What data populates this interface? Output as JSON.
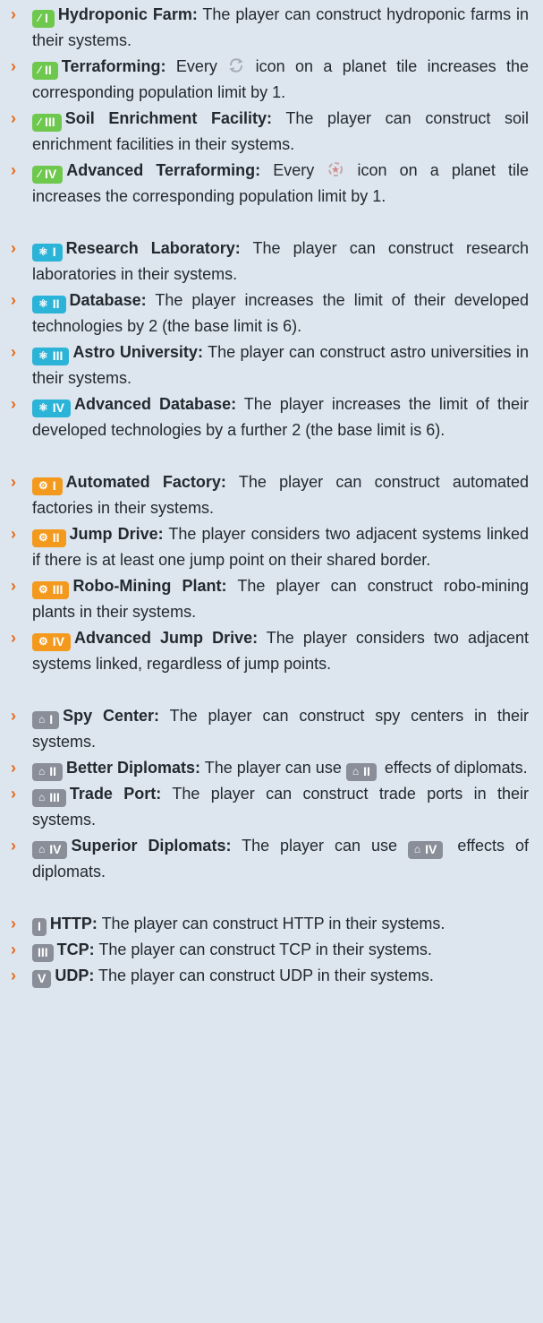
{
  "colors": {
    "green": "#6ec84e",
    "blue": "#2bb4d8",
    "orange": "#f39a1e",
    "gray": "#898e99",
    "arrow": "#e96a1b"
  },
  "items": [
    {
      "badge": "I",
      "sym": "∕",
      "name": "Hydroponic Farm:",
      "desc": " The player can construct hydroponic farms in their systems."
    },
    {
      "badge": "II",
      "sym": "∕",
      "name": "Terraforming:",
      "pre": " Every ",
      "post": " icon on a planet tile increases the corresponding population limit by 1."
    },
    {
      "badge": "III",
      "sym": "∕",
      "name": "Soil Enrichment Facility:",
      "desc": " The player can construct soil enrichment facilities in their systems."
    },
    {
      "badge": "IV",
      "sym": "∕",
      "name": "Advanced Terraforming:",
      "pre": " Every ",
      "post": " icon on a planet tile increases the corresponding population limit by 1."
    },
    {
      "badge": "I",
      "sym": "⚛",
      "name": "Research Laboratory:",
      "desc": " The player can construct research laboratories in their systems."
    },
    {
      "badge": "II",
      "sym": "⚛",
      "name": "Database:",
      "desc": " The player increases the limit of their developed technologies by 2 (the base limit is 6)."
    },
    {
      "badge": "III",
      "sym": "⚛",
      "name": "Astro University:",
      "desc": " The player can construct astro universities in their systems."
    },
    {
      "badge": "IV",
      "sym": "⚛",
      "name": "Advanced Database:",
      "desc": " The player increases the limit of their developed technologies by a further 2 (the base limit is 6)."
    },
    {
      "badge": "I",
      "sym": "⚙",
      "name": "Automated Factory:",
      "desc": " The player can construct automated factories in their systems."
    },
    {
      "badge": "II",
      "sym": "⚙",
      "name": "Jump Drive:",
      "desc": " The player considers two adjacent systems linked if there is at least one jump point on their shared border."
    },
    {
      "badge": "III",
      "sym": "⚙",
      "name": "Robo-Mining Plant:",
      "desc": " The player can construct robo-mining plants in their systems."
    },
    {
      "badge": "IV",
      "sym": "⚙",
      "name": "Advanced Jump Drive:",
      "desc": " The player considers two adjacent systems linked, regardless of jump points."
    },
    {
      "badge": "I",
      "sym": "⌂",
      "name": "Spy Center:",
      "desc": " The player can construct spy centers in their systems."
    },
    {
      "badge": "II",
      "sym": "⌂",
      "name": "Better Diplomats:",
      "pre": " The player can use ",
      "post": " effects of diplomats.",
      "inline_badge": "II"
    },
    {
      "badge": "III",
      "sym": "⌂",
      "name": "Trade Port:",
      "desc": " The player can construct trade ports in their systems."
    },
    {
      "badge": "IV",
      "sym": "⌂",
      "name": "Superior Diplomats:",
      "pre": " The player can use ",
      "post": " effects of diplomats.",
      "inline_badge": "IV"
    },
    {
      "badge": "I",
      "name": "HTTP:",
      "desc": " The player can construct HTTP in their systems."
    },
    {
      "badge": "III",
      "name": "TCP:",
      "desc": " The player can construct TCP in their systems."
    },
    {
      "badge": "V",
      "name": "UDP:",
      "desc": " The player can construct UDP in their systems."
    }
  ]
}
